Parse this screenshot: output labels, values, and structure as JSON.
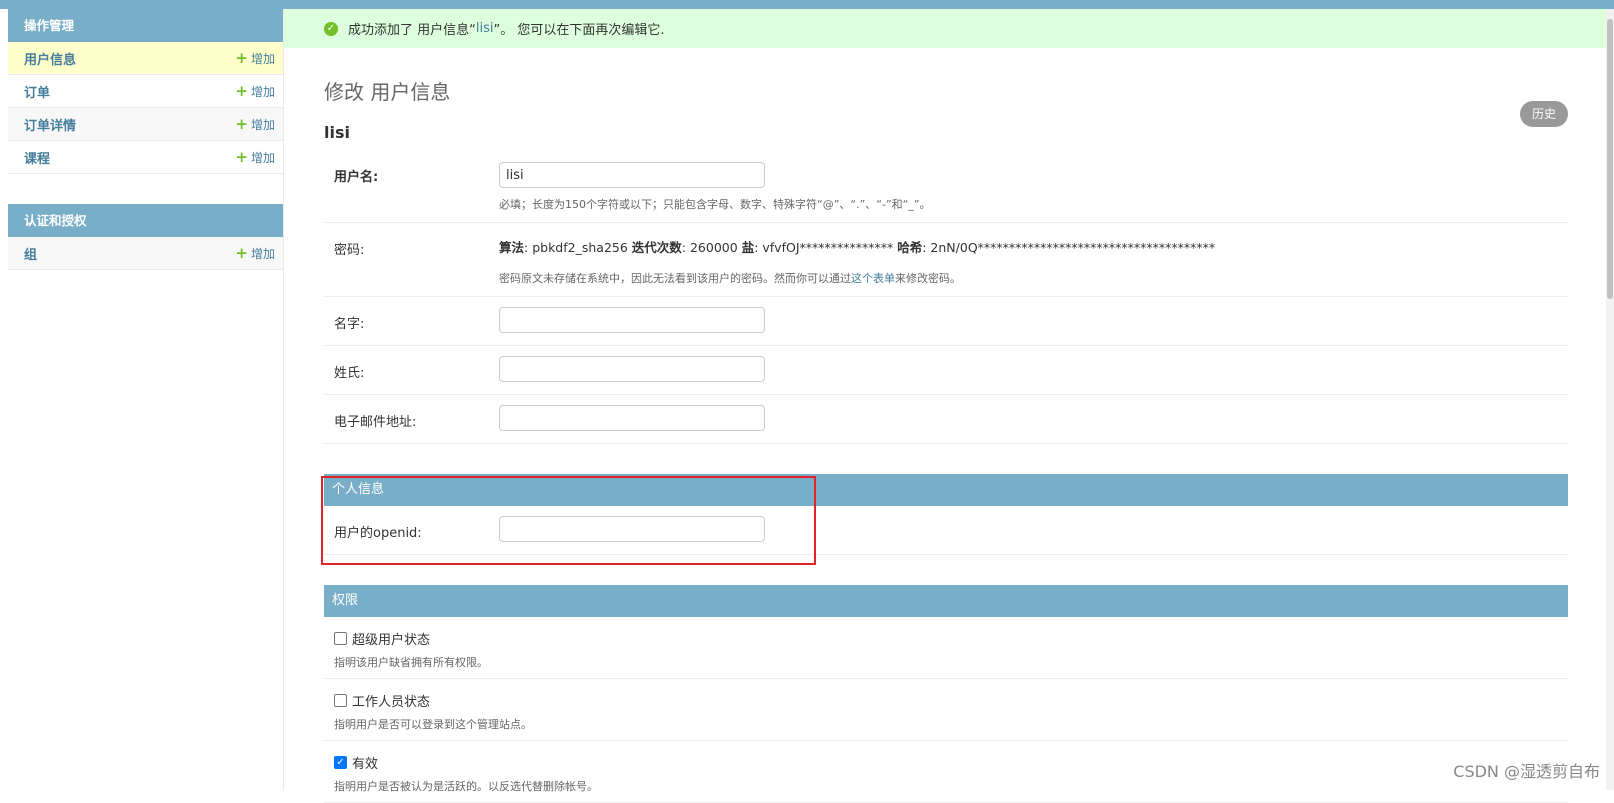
{
  "sidebar": {
    "modules": [
      {
        "caption": "操作管理",
        "items": [
          {
            "label": "用户信息",
            "add_label": "增加",
            "current": true
          },
          {
            "label": "订单",
            "add_label": "增加"
          },
          {
            "label": "订单详情",
            "add_label": "增加"
          },
          {
            "label": "课程",
            "add_label": "增加"
          }
        ]
      },
      {
        "caption": "认证和授权",
        "items": [
          {
            "label": "组",
            "add_label": "增加"
          }
        ]
      }
    ]
  },
  "message": {
    "prefix": "成功添加了 用户信息“",
    "link": "lisi",
    "suffix": "”。 您可以在下面再次编辑它."
  },
  "page": {
    "title": "修改 用户信息",
    "object_title": "lisi",
    "history_button": "历史"
  },
  "form": {
    "username": {
      "label": "用户名:",
      "value": "lisi",
      "help": "必填；长度为150个字符或以下；只能包含字母、数字、特殊字符“@”、“.”、“-”和“_”。"
    },
    "password": {
      "label": "密码:",
      "algo_label": "算法",
      "algo_value": ": pbkdf2_sha256 ",
      "iter_label": "迭代次数",
      "iter_value": ": 260000 ",
      "salt_label": "盐",
      "salt_value": ": vfvfOJ*************** ",
      "hash_label": "哈希",
      "hash_value": ": 2nN/0Q**************************************",
      "help_prefix": "密码原文未存储在系统中，因此无法看到该用户的密码。然而你可以通过",
      "help_link": "这个表单",
      "help_suffix": "来修改密码。"
    },
    "first_name": {
      "label": "名字:",
      "value": ""
    },
    "last_name": {
      "label": "姓氏:",
      "value": ""
    },
    "email": {
      "label": "电子邮件地址:",
      "value": ""
    }
  },
  "personal_info": {
    "caption": "个人信息",
    "openid": {
      "label": "用户的openid:",
      "value": ""
    }
  },
  "permissions": {
    "caption": "权限",
    "superuser": {
      "label": "超级用户状态",
      "help": "指明该用户缺省拥有所有权限。",
      "checked": false
    },
    "staff": {
      "label": "工作人员状态",
      "help": "指明用户是否可以登录到这个管理站点。",
      "checked": false
    },
    "active": {
      "label": "有效",
      "help": "指明用户是否被认为是活跃的。以反选代替删除帐号。",
      "checked": true
    }
  },
  "watermark": "CSDN @湿透剪自布"
}
